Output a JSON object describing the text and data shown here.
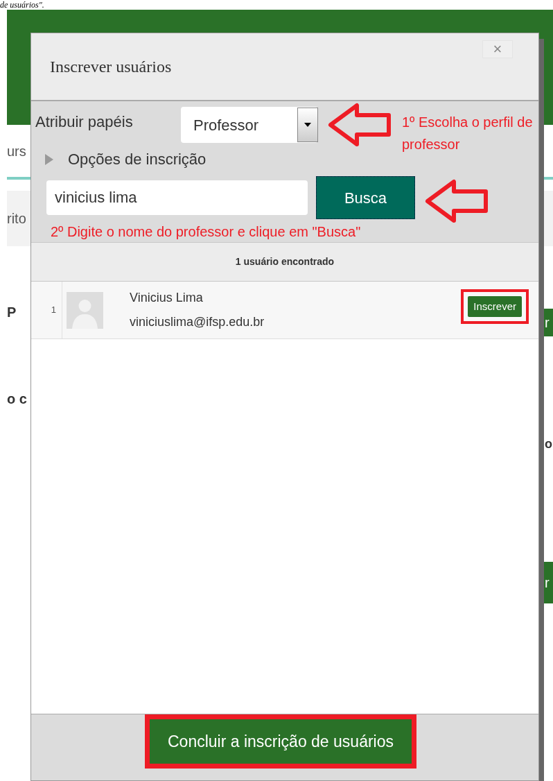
{
  "page_caption": "de usuários\".",
  "background": {
    "left_fragments": [
      "urs",
      "rito",
      "P",
      "o c"
    ],
    "right_fragments": [
      "o"
    ],
    "right_buttons": [
      "r",
      "r"
    ]
  },
  "dialog": {
    "title": "Inscrever usuários",
    "close": "×",
    "role_label": "Atribuir papéis",
    "role_value": "Professor",
    "options": {
      "label": "Opções de inscrição",
      "expanded": false
    },
    "search": {
      "value": "vinicius lima",
      "button": "Busca"
    },
    "results_header": "1 usuário encontrado",
    "users": [
      {
        "index": "1",
        "name": "Vinicius Lima",
        "email": "viniciuslima@ifsp.edu.br",
        "button": "Inscrever"
      }
    ],
    "finish_button": "Concluir a inscrição de usuários"
  },
  "annotations": [
    "1º Escolha o perfil de professor",
    "2º Digite o nome do professor e clique em \"Busca\""
  ]
}
